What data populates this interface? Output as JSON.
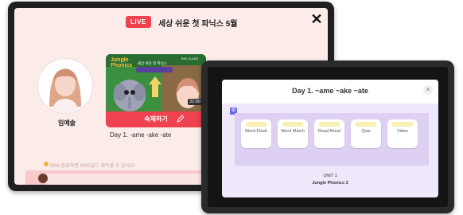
{
  "tabletA": {
    "live_badge": "LIVE",
    "title": "세상 쉬운 첫 파닉스 5월",
    "close_label": "✕",
    "teacher_name": "임예솔",
    "card": {
      "logo": "Jungle Phonics",
      "banner": "세상 쉬운 첫 파닉스",
      "brand": "BIG CLASS",
      "time": "31:00",
      "button_label": "숙제하기"
    },
    "day_label": "Day 1. -ame -ake -ate",
    "notice": "90% 완료하면 3000골드 획득할 수 있어요!"
  },
  "tabletB": {
    "day_title": "Day 1. ~ame ~ake ~ate",
    "close_label": "×",
    "activities": [
      {
        "label": "Word Flash"
      },
      {
        "label": "Word Match"
      },
      {
        "label": "Read Aloud"
      },
      {
        "label": "Quiz"
      },
      {
        "label": "Video"
      }
    ],
    "unit": "UNIT 1",
    "book": "Jungle Phonics 3"
  },
  "colors": {
    "live_red": "#f0414f",
    "panel_bg": "#efe8fa",
    "lavender": "#ddd0f3",
    "chip_yellow": "#faf0b4"
  }
}
